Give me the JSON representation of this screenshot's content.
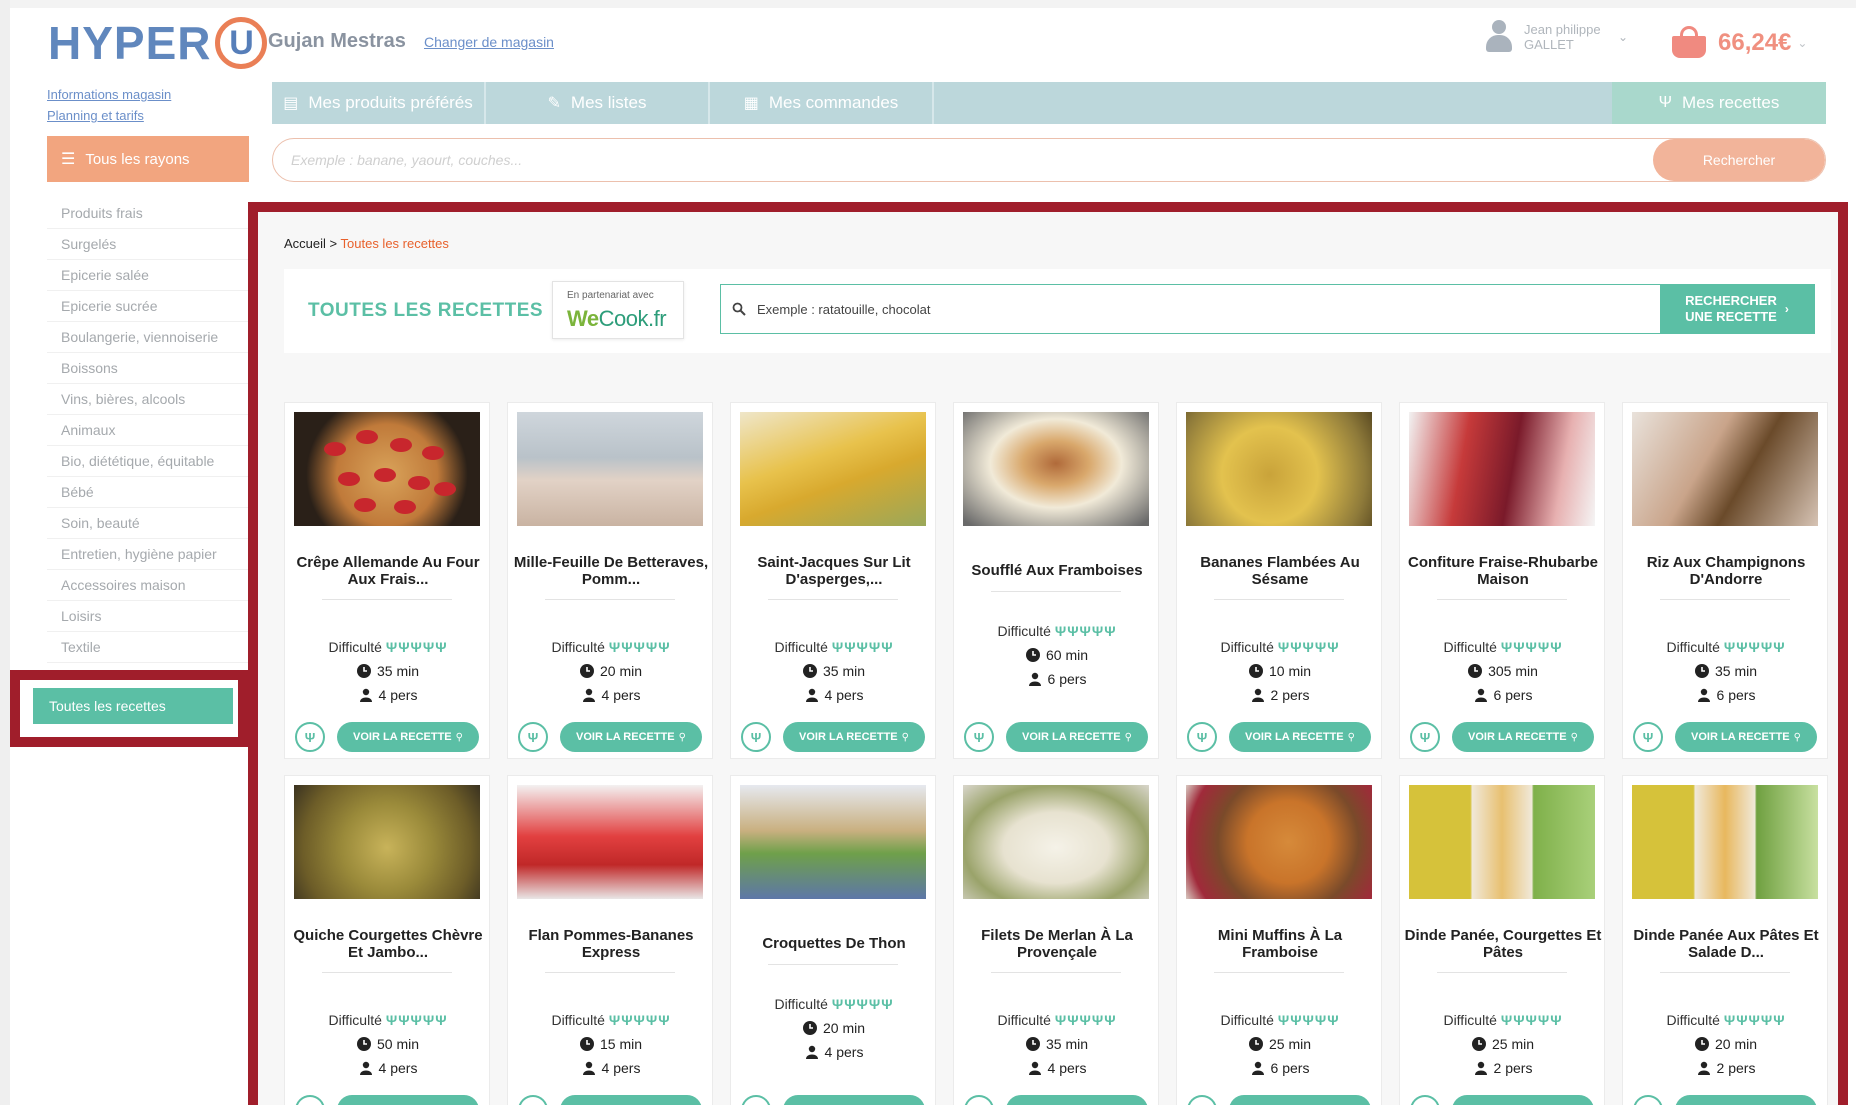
{
  "header": {
    "logo_text": "HYPER",
    "logo_letter": "U",
    "store_name": "Gujan Mestras",
    "change_store": "Changer de magasin",
    "user_name": "Jean philippe GALLET",
    "cart_total": "66,24€"
  },
  "sidebar": {
    "links": [
      "Informations magasin",
      "Planning et tarifs"
    ],
    "all_rayons": "Tous les rayons",
    "items": [
      "Produits frais",
      "Surgelés",
      "Epicerie salée",
      "Epicerie sucrée",
      "Boulangerie, viennoiserie",
      "Boissons",
      "Vins, bières, alcools",
      "Animaux",
      "Bio, diététique, équitable",
      "Bébé",
      "Soin, beauté",
      "Entretien, hygiène papier",
      "Accessoires maison",
      "Loisirs",
      "Textile"
    ],
    "active": "Toutes les recettes"
  },
  "tabs": {
    "favorites": "Mes produits préférés",
    "lists": "Mes listes",
    "orders": "Mes commandes",
    "recipes": "Mes recettes"
  },
  "search": {
    "placeholder": "Exemple : banane, yaourt, couches...",
    "button": "Rechercher"
  },
  "breadcrumb": {
    "home": "Accueil",
    "sep": " > ",
    "current": "Toutes les recettes"
  },
  "recipes_header": {
    "title": "TOUTES LES RECETTES",
    "partner_line": "En partenariat avec",
    "partner_brand_a": "We",
    "partner_brand_b": "Cook.fr",
    "search_placeholder": "Exemple : ratatouille, chocolat",
    "search_button_1": "RECHERCHER",
    "search_button_2": "UNE RECETTE"
  },
  "labels": {
    "difficulty": "Difficulté",
    "forks": "ΨΨΨΨΨ",
    "view_recipe": "VOIR LA RECETTE"
  },
  "recipes": [
    {
      "name": "Crêpe Allemande Au Four Aux Frais...",
      "time": "35 min",
      "people": "4 pers",
      "image": "im-crepe"
    },
    {
      "name": "Mille-Feuille De Betteraves, Pomm...",
      "time": "20 min",
      "people": "4 pers",
      "image": "im-mille"
    },
    {
      "name": "Saint-Jacques Sur Lit D'asperges,...",
      "time": "35 min",
      "people": "4 pers",
      "image": "im-sj"
    },
    {
      "name": "Soufflé Aux Framboises",
      "time": "60 min",
      "people": "6 pers",
      "image": "im-souffle"
    },
    {
      "name": "Bananes Flambées Au Sésame",
      "time": "10 min",
      "people": "2 pers",
      "image": "im-banane"
    },
    {
      "name": "Confiture Fraise-Rhubarbe Maison",
      "time": "305 min",
      "people": "6 pers",
      "image": "im-confit"
    },
    {
      "name": "Riz Aux Champignons D'Andorre",
      "time": "35 min",
      "people": "6 pers",
      "image": "im-riz"
    },
    {
      "name": "Quiche Courgettes Chèvre Et Jambo...",
      "time": "50 min",
      "people": "4 pers",
      "image": "im-quiche"
    },
    {
      "name": "Flan Pommes-Bananes Express",
      "time": "15 min",
      "people": "4 pers",
      "image": "im-flan"
    },
    {
      "name": "Croquettes De Thon",
      "time": "20 min",
      "people": "4 pers",
      "image": "im-croq"
    },
    {
      "name": "Filets De Merlan À La Provençale",
      "time": "35 min",
      "people": "4 pers",
      "image": "im-merlan"
    },
    {
      "name": "Mini Muffins À La Framboise",
      "time": "25 min",
      "people": "6 pers",
      "image": "im-muffin"
    },
    {
      "name": "Dinde Panée, Courgettes Et Pâtes",
      "time": "25 min",
      "people": "2 pers",
      "image": "im-dinde1"
    },
    {
      "name": "Dinde Panée Aux Pâtes Et Salade D...",
      "time": "20 min",
      "people": "2 pers",
      "image": "im-dinde2"
    }
  ]
}
